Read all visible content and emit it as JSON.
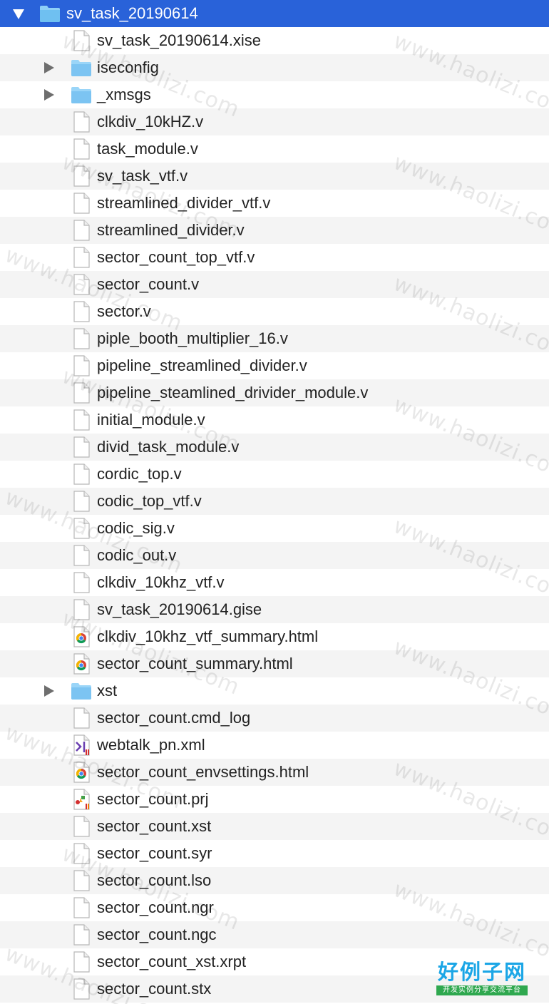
{
  "root": {
    "name": "sv_task_20190614",
    "expanded": true
  },
  "items": [
    {
      "name": "sv_task_20190614.xise",
      "kind": "doc",
      "icon": "document-icon"
    },
    {
      "name": "iseconfig",
      "kind": "folder",
      "icon": "folder-icon"
    },
    {
      "name": "_xmsgs",
      "kind": "folder",
      "icon": "folder-icon"
    },
    {
      "name": "clkdiv_10kHZ.v",
      "kind": "doc",
      "icon": "document-icon"
    },
    {
      "name": "task_module.v",
      "kind": "doc",
      "icon": "document-icon"
    },
    {
      "name": "sv_task_vtf.v",
      "kind": "doc",
      "icon": "document-icon"
    },
    {
      "name": "streamlined_divider_vtf.v",
      "kind": "doc",
      "icon": "document-icon"
    },
    {
      "name": "streamlined_divider.v",
      "kind": "doc",
      "icon": "document-icon"
    },
    {
      "name": "sector_count_top_vtf.v",
      "kind": "doc",
      "icon": "document-icon"
    },
    {
      "name": "sector_count.v",
      "kind": "doc",
      "icon": "document-icon"
    },
    {
      "name": "sector.v",
      "kind": "doc",
      "icon": "document-icon"
    },
    {
      "name": "piple_booth_multiplier_16.v",
      "kind": "doc",
      "icon": "document-icon"
    },
    {
      "name": "pipeline_streamlined_divider.v",
      "kind": "doc",
      "icon": "document-icon"
    },
    {
      "name": "pipeline_steamlined_drivider_module.v",
      "kind": "doc",
      "icon": "document-icon"
    },
    {
      "name": "initial_module.v",
      "kind": "doc",
      "icon": "document-icon"
    },
    {
      "name": "divid_task_module.v",
      "kind": "doc",
      "icon": "document-icon"
    },
    {
      "name": "cordic_top.v",
      "kind": "doc",
      "icon": "document-icon"
    },
    {
      "name": "codic_top_vtf.v",
      "kind": "doc",
      "icon": "document-icon"
    },
    {
      "name": "codic_sig.v",
      "kind": "doc",
      "icon": "document-icon"
    },
    {
      "name": "codic_out.v",
      "kind": "doc",
      "icon": "document-icon"
    },
    {
      "name": "clkdiv_10khz_vtf.v",
      "kind": "doc",
      "icon": "document-icon"
    },
    {
      "name": "sv_task_20190614.gise",
      "kind": "doc",
      "icon": "document-icon"
    },
    {
      "name": "clkdiv_10khz_vtf_summary.html",
      "kind": "chrome",
      "icon": "chrome-html-icon"
    },
    {
      "name": "sector_count_summary.html",
      "kind": "chrome",
      "icon": "chrome-html-icon"
    },
    {
      "name": "xst",
      "kind": "folder",
      "icon": "folder-icon"
    },
    {
      "name": "sector_count.cmd_log",
      "kind": "doc",
      "icon": "document-icon"
    },
    {
      "name": "webtalk_pn.xml",
      "kind": "xml",
      "icon": "xml-file-icon"
    },
    {
      "name": "sector_count_envsettings.html",
      "kind": "chrome",
      "icon": "chrome-html-icon"
    },
    {
      "name": "sector_count.prj",
      "kind": "prj",
      "icon": "project-file-icon"
    },
    {
      "name": "sector_count.xst",
      "kind": "doc",
      "icon": "document-icon"
    },
    {
      "name": "sector_count.syr",
      "kind": "doc",
      "icon": "document-icon"
    },
    {
      "name": "sector_count.lso",
      "kind": "doc",
      "icon": "document-icon"
    },
    {
      "name": "sector_count.ngr",
      "kind": "doc",
      "icon": "document-icon"
    },
    {
      "name": "sector_count.ngc",
      "kind": "doc",
      "icon": "document-icon"
    },
    {
      "name": "sector_count_xst.xrpt",
      "kind": "doc",
      "icon": "document-icon"
    },
    {
      "name": "sector_count.stx",
      "kind": "doc",
      "icon": "document-icon"
    }
  ],
  "watermark": "www.haolizi.com",
  "logo": {
    "title": "好例子网",
    "subtitle": "开发实例分享交流平台"
  },
  "colors": {
    "selection": "#2962d9",
    "folder": "#7cc4f2",
    "stripe": "#f4f4f4"
  }
}
